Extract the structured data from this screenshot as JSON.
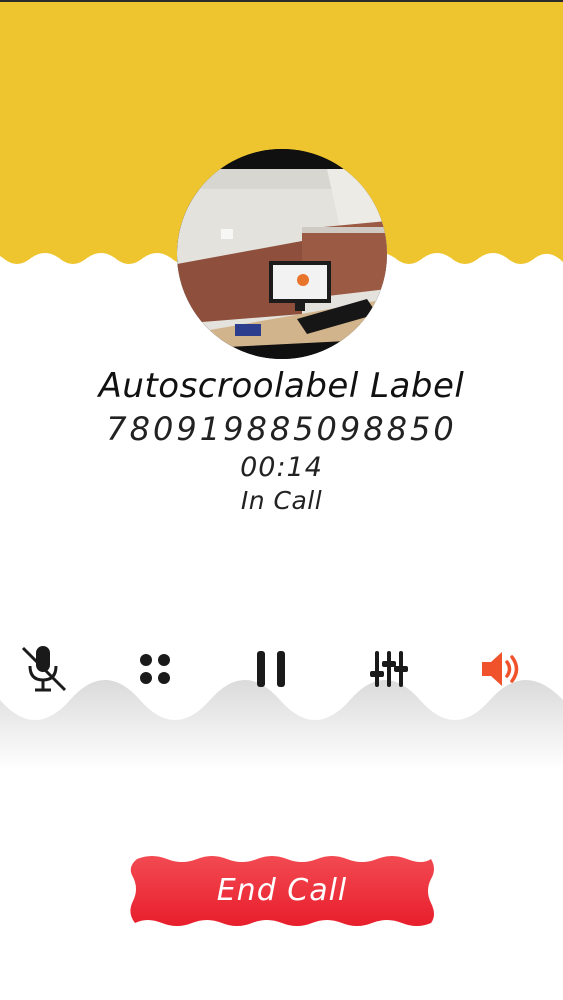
{
  "caller": {
    "name": "Autoscroolabel Label",
    "number": "780919885098850",
    "timer": "00:14",
    "status": "In Call"
  },
  "controls": [
    {
      "icon": "mic-muted-icon",
      "name": "mute-button"
    },
    {
      "icon": "dialpad-icon",
      "name": "dialpad-button"
    },
    {
      "icon": "pause-icon",
      "name": "hold-button"
    },
    {
      "icon": "equalizer-icon",
      "name": "audio-settings-button"
    },
    {
      "icon": "speaker-icon",
      "name": "speaker-button",
      "active": true
    }
  ],
  "end_call": {
    "label": "End Call"
  },
  "colors": {
    "header_yellow": "#EFC52F",
    "end_call_red": "#EE2A36",
    "speaker_active": "#F0522B",
    "icon_dark": "#1A1A1A"
  }
}
